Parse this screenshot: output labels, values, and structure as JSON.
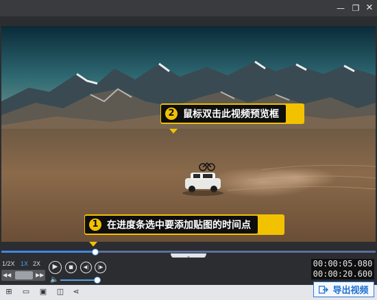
{
  "window": {
    "minimize_icon": "minimize-icon",
    "restore_icon": "restore-icon",
    "close_icon": "close-icon"
  },
  "callouts": [
    {
      "number": "2",
      "text": "鼠标双击此视频预览框"
    },
    {
      "number": "1",
      "text": "在进度条选中要添加贴图的时间点"
    }
  ],
  "progress": {
    "played_fraction": 0.25,
    "accent": "#3f88e6"
  },
  "speed": {
    "options": [
      "1/2X",
      "1X",
      "2X"
    ],
    "selected": "1X"
  },
  "playback": {
    "play_icon": "play-icon",
    "stop_icon": "stop-icon",
    "prev_icon": "prev-frame-icon",
    "next_icon": "next-frame-icon"
  },
  "volume": {
    "level": 0.95
  },
  "time": {
    "current": "00:00:05.080",
    "total": "00:00:20.600"
  },
  "toolbar": {
    "icons": [
      "new-project-icon",
      "open-folder-icon",
      "save-icon",
      "save-as-icon",
      "share-icon"
    ],
    "export_label": "导出视频",
    "export_color": "#1f6fd1"
  },
  "colors": {
    "callout": "#f2c200",
    "background": "#2c2d31"
  }
}
